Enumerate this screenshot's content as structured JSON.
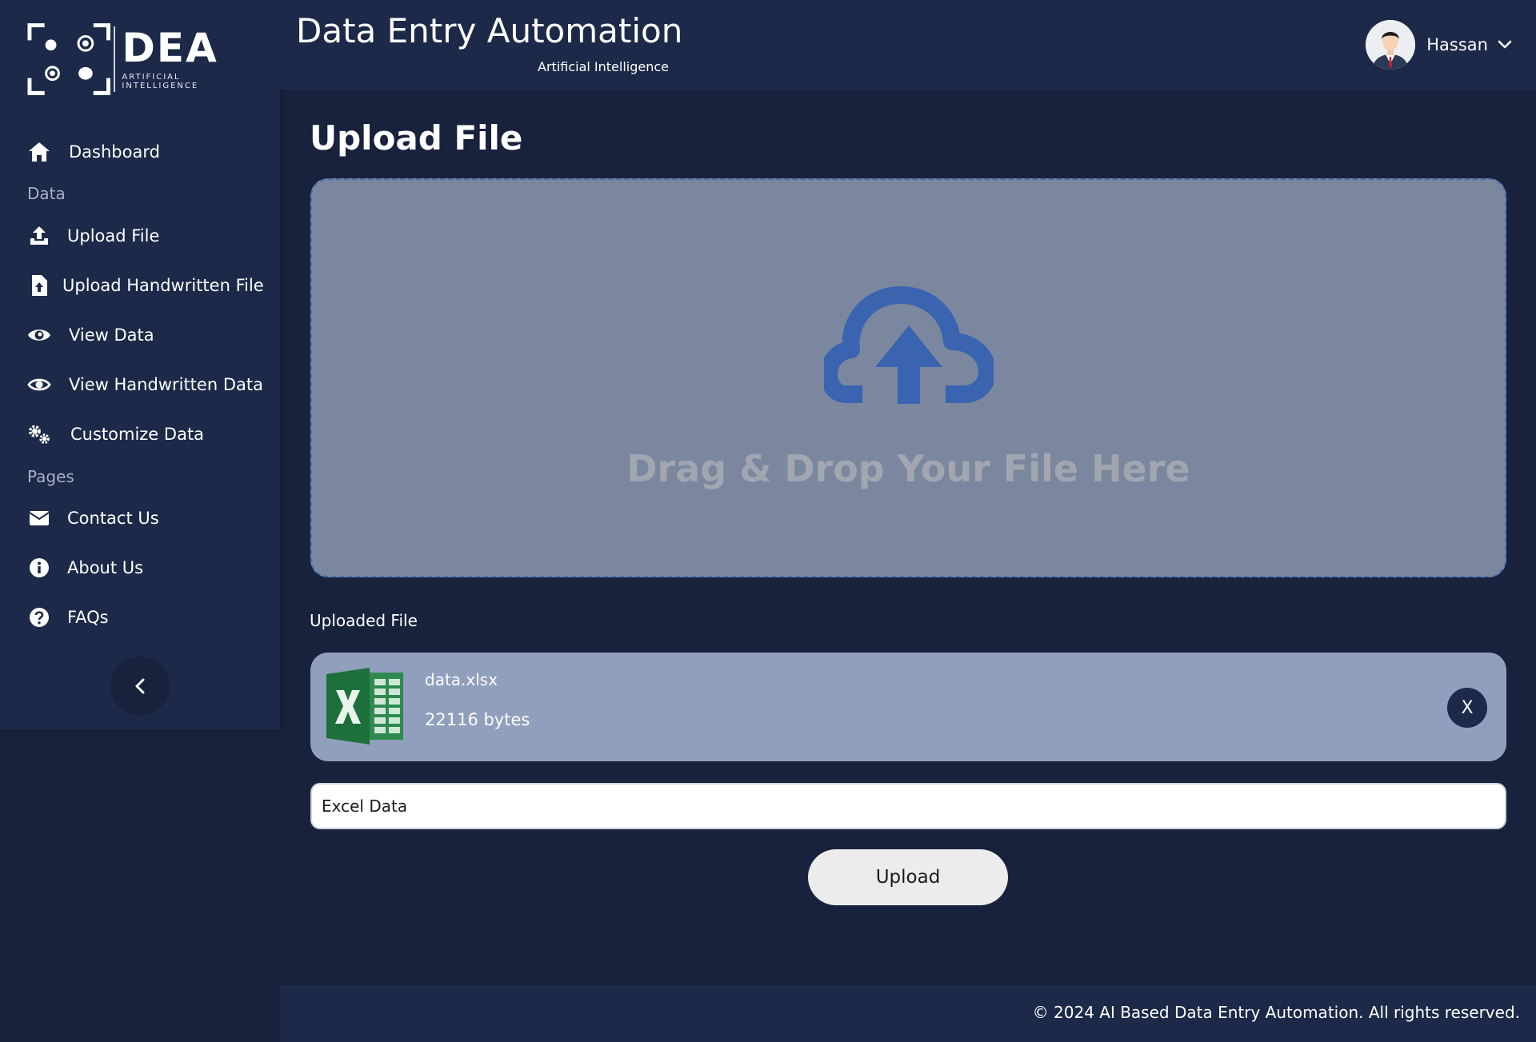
{
  "brand": {
    "logo_word": "DEA",
    "logo_sub": "ARTIFICIAL INTELLIGENCE",
    "app_title": "Data Entry Automation",
    "app_subtitle": "Artificial Intelligence"
  },
  "user": {
    "name": "Hassan"
  },
  "sidebar": {
    "items": [
      {
        "label": "Dashboard",
        "icon": "home-icon"
      },
      {
        "section": "Data"
      },
      {
        "label": "Upload File",
        "icon": "upload-icon"
      },
      {
        "label": "Upload Handwritten File",
        "icon": "file-upload-icon"
      },
      {
        "label": "View Data",
        "icon": "eye-icon"
      },
      {
        "label": "View Handwritten Data",
        "icon": "eye-outline-icon"
      },
      {
        "label": "Customize Data",
        "icon": "gears-icon"
      },
      {
        "section": "Pages"
      },
      {
        "label": "Contact Us",
        "icon": "envelope-icon"
      },
      {
        "label": "About Us",
        "icon": "info-icon"
      },
      {
        "label": "FAQs",
        "icon": "question-icon"
      }
    ]
  },
  "main": {
    "page_title": "Upload File",
    "dropzone_text": "Drag & Drop Your File Here",
    "uploaded_label": "Uploaded File",
    "file": {
      "name": "data.xlsx",
      "size": "22116 bytes",
      "remove_label": "X"
    },
    "name_input_value": "Excel Data",
    "upload_button": "Upload"
  },
  "footer": {
    "text": "© 2024 AI Based Data Entry Automation. All rights reserved."
  },
  "colors": {
    "background": "#18223d",
    "panel": "#1c2948",
    "dropzone": "#7a879f",
    "accent": "#3a64b0",
    "file_card": "#909fbc"
  }
}
